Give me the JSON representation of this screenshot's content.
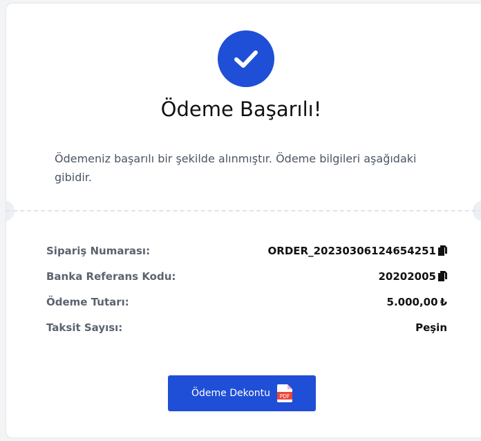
{
  "status": {
    "title": "Ödeme Başarılı!",
    "description": "Ödemeniz başarılı bir şekilde alınmıştır. Ödeme bilgileri aşağıdaki gibidir.",
    "icon": "check-circle-icon"
  },
  "details": [
    {
      "label": "Sipariş Numarası:",
      "value": "ORDER_20230306124654251",
      "copyable": true
    },
    {
      "label": "Banka Referans Kodu:",
      "value": "20202005",
      "copyable": true
    },
    {
      "label": "Ödeme Tutarı:",
      "value": "5.000,00",
      "currency": "₺"
    },
    {
      "label": "Taksit Sayısı:",
      "value": "Peşin"
    }
  ],
  "receipt_button": {
    "label": "Ödeme Dekontu",
    "icon": "pdf-file-icon",
    "icon_text": "PDF"
  },
  "colors": {
    "accent": "#1f4fd6",
    "pdf_red": "#e8473b"
  }
}
